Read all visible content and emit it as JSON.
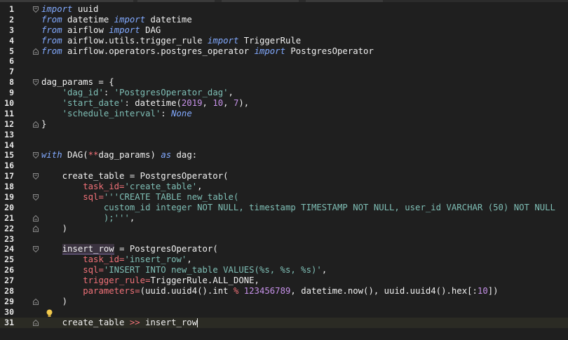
{
  "editor": {
    "lines": [
      {
        "n": "1",
        "fold": "open",
        "segments": [
          {
            "t": "import",
            "c": "kw"
          },
          {
            "t": " uuid",
            "c": ""
          }
        ]
      },
      {
        "n": "2",
        "segments": [
          {
            "t": "from",
            "c": "kw"
          },
          {
            "t": " datetime ",
            "c": ""
          },
          {
            "t": "import",
            "c": "kw"
          },
          {
            "t": " datetime",
            "c": ""
          }
        ]
      },
      {
        "n": "3",
        "segments": [
          {
            "t": "from",
            "c": "kw"
          },
          {
            "t": " airflow ",
            "c": ""
          },
          {
            "t": "import",
            "c": "kw"
          },
          {
            "t": " DAG",
            "c": ""
          }
        ]
      },
      {
        "n": "4",
        "segments": [
          {
            "t": "from",
            "c": "kw"
          },
          {
            "t": " airflow.utils.trigger_rule ",
            "c": ""
          },
          {
            "t": "import",
            "c": "kw"
          },
          {
            "t": " TriggerRule",
            "c": ""
          }
        ]
      },
      {
        "n": "5",
        "fold": "close",
        "segments": [
          {
            "t": "from",
            "c": "kw"
          },
          {
            "t": " airflow.operators.postgres_operator ",
            "c": ""
          },
          {
            "t": "import",
            "c": "kw"
          },
          {
            "t": " PostgresOperator",
            "c": ""
          }
        ]
      },
      {
        "n": "6",
        "segments": []
      },
      {
        "n": "7",
        "segments": []
      },
      {
        "n": "8",
        "fold": "open",
        "segments": [
          {
            "t": "dag_params = {",
            "c": ""
          }
        ]
      },
      {
        "n": "9",
        "segments": [
          {
            "t": "    ",
            "c": ""
          },
          {
            "t": "'dag_id'",
            "c": "str"
          },
          {
            "t": ": ",
            "c": ""
          },
          {
            "t": "'PostgresOperator_dag'",
            "c": "str"
          },
          {
            "t": ",",
            "c": ""
          }
        ]
      },
      {
        "n": "10",
        "segments": [
          {
            "t": "    ",
            "c": ""
          },
          {
            "t": "'start_date'",
            "c": "str"
          },
          {
            "t": ": datetime(",
            "c": ""
          },
          {
            "t": "2019",
            "c": "num"
          },
          {
            "t": ", ",
            "c": ""
          },
          {
            "t": "10",
            "c": "num"
          },
          {
            "t": ", ",
            "c": ""
          },
          {
            "t": "7",
            "c": "num"
          },
          {
            "t": "),",
            "c": ""
          }
        ]
      },
      {
        "n": "11",
        "segments": [
          {
            "t": "    ",
            "c": ""
          },
          {
            "t": "'schedule_interval'",
            "c": "str"
          },
          {
            "t": ": ",
            "c": ""
          },
          {
            "t": "None",
            "c": "none"
          }
        ]
      },
      {
        "n": "12",
        "fold": "close",
        "segments": [
          {
            "t": "}",
            "c": ""
          }
        ]
      },
      {
        "n": "13",
        "segments": []
      },
      {
        "n": "14",
        "segments": []
      },
      {
        "n": "15",
        "fold": "open",
        "segments": [
          {
            "t": "with",
            "c": "kw"
          },
          {
            "t": " DAG(",
            "c": ""
          },
          {
            "t": "**",
            "c": "op"
          },
          {
            "t": "dag_params) ",
            "c": ""
          },
          {
            "t": "as",
            "c": "kw"
          },
          {
            "t": " dag:",
            "c": ""
          }
        ]
      },
      {
        "n": "16",
        "segments": []
      },
      {
        "n": "17",
        "fold": "open",
        "segments": [
          {
            "t": "    create_table = PostgresOperator(",
            "c": ""
          }
        ]
      },
      {
        "n": "18",
        "segments": [
          {
            "t": "        ",
            "c": ""
          },
          {
            "t": "task_id=",
            "c": "param"
          },
          {
            "t": "'create_table'",
            "c": "str"
          },
          {
            "t": ",",
            "c": ""
          }
        ]
      },
      {
        "n": "19",
        "fold": "open",
        "segments": [
          {
            "t": "        ",
            "c": ""
          },
          {
            "t": "sql=",
            "c": "param"
          },
          {
            "t": "'''CREATE TABLE new_table(",
            "c": "str"
          }
        ]
      },
      {
        "n": "20",
        "segments": [
          {
            "t": "            custom_id integer NOT NULL, timestamp TIMESTAMP NOT NULL, user_id VARCHAR (50) NOT NULL",
            "c": "str"
          }
        ]
      },
      {
        "n": "21",
        "fold": "close",
        "segments": [
          {
            "t": "            );'''",
            "c": "str"
          },
          {
            "t": ",",
            "c": ""
          }
        ]
      },
      {
        "n": "22",
        "fold": "close",
        "segments": [
          {
            "t": "    )",
            "c": ""
          }
        ]
      },
      {
        "n": "23",
        "segments": []
      },
      {
        "n": "24",
        "fold": "open",
        "segments": [
          {
            "t": "    ",
            "c": ""
          },
          {
            "t": "insert_row",
            "c": "",
            "u": true
          },
          {
            "t": " = PostgresOperator(",
            "c": ""
          }
        ]
      },
      {
        "n": "25",
        "segments": [
          {
            "t": "        ",
            "c": ""
          },
          {
            "t": "task_id=",
            "c": "param"
          },
          {
            "t": "'insert_row'",
            "c": "str"
          },
          {
            "t": ",",
            "c": ""
          }
        ]
      },
      {
        "n": "26",
        "segments": [
          {
            "t": "        ",
            "c": ""
          },
          {
            "t": "sql=",
            "c": "param"
          },
          {
            "t": "'INSERT INTO new_table VALUES(%s, %s, %s)'",
            "c": "str"
          },
          {
            "t": ",",
            "c": ""
          }
        ]
      },
      {
        "n": "27",
        "segments": [
          {
            "t": "        ",
            "c": ""
          },
          {
            "t": "trigger_rule=",
            "c": "param"
          },
          {
            "t": "TriggerRule.ALL_DONE,",
            "c": ""
          }
        ]
      },
      {
        "n": "28",
        "segments": [
          {
            "t": "        ",
            "c": ""
          },
          {
            "t": "parameters=",
            "c": "param"
          },
          {
            "t": "(uuid.uuid4().int ",
            "c": ""
          },
          {
            "t": "%",
            "c": "op"
          },
          {
            "t": " ",
            "c": ""
          },
          {
            "t": "123456789",
            "c": "num"
          },
          {
            "t": ", datetime.now(), uuid.uuid4().hex[:",
            "c": ""
          },
          {
            "t": "10",
            "c": "num"
          },
          {
            "t": "])",
            "c": ""
          }
        ]
      },
      {
        "n": "29",
        "fold": "close",
        "segments": [
          {
            "t": "    )",
            "c": ""
          }
        ]
      },
      {
        "n": "30",
        "bulb": true,
        "segments": []
      },
      {
        "n": "31",
        "current": true,
        "fold": "close",
        "segments": [
          {
            "t": "    create_table ",
            "c": ""
          },
          {
            "t": ">>",
            "c": "op"
          },
          {
            "t": " insert_row",
            "c": ""
          }
        ]
      }
    ],
    "colors": {
      "keyword": "#82aaff",
      "string": "#7fbfb6",
      "number": "#c792ea",
      "param": "#f07178",
      "text": "#f0f0f0",
      "background": "#1f1f1f"
    },
    "icons": {
      "fold_open": "fold-open-icon",
      "fold_close": "fold-close-icon",
      "bulb": "lightbulb-icon"
    }
  }
}
